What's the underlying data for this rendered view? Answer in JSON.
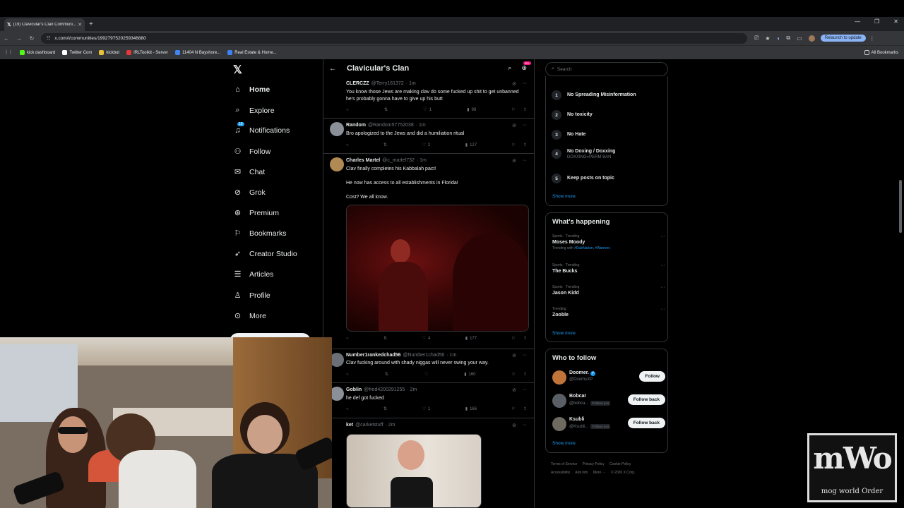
{
  "browser": {
    "tab_title": "(19) Clavicular's Clan Communi...",
    "url": "x.com/i/communities/1992797520259346880",
    "relaunch": "Relaunch to update",
    "bookmarks": [
      "kick dashboard",
      "Twitter Com",
      "kickbot",
      "IRLToolkit - Server",
      "11404 N Bayshore...",
      "Real Estate & Home..."
    ],
    "all_bookmarks": "All Bookmarks"
  },
  "nav": {
    "items": [
      "Home",
      "Explore",
      "Notifications",
      "Follow",
      "Chat",
      "Grok",
      "Premium",
      "Bookmarks",
      "Creator Studio",
      "Articles",
      "Profile",
      "More"
    ],
    "notif_badge": "19"
  },
  "community": {
    "title": "Clavicular's Clan",
    "header_badge": "20+"
  },
  "tweets": [
    {
      "name": "CLERCZZ",
      "handle": "@Terry161372",
      "time": "· 1m",
      "text": "You know those Jews are making clav do some fucked up shit to get unbanned he's probably gonna have to give up his butt",
      "likes": "1",
      "views": "98"
    },
    {
      "name": "Random",
      "handle": "@Random57752038",
      "time": "· 1m",
      "text": "Bro apologized to the Jews and did a humiliation ritual",
      "likes": "2",
      "views": "127"
    },
    {
      "name": "Charles Martel",
      "handle": "@c_martel732",
      "time": "· 1m",
      "text1": "Clav finally completes his Kabbalah pact!",
      "text2": "He now has access to all establishments in Florida!",
      "text3": "Cost? We all know.",
      "likes": "4",
      "views": "177"
    },
    {
      "name": "Number1rankedchad56",
      "handle": "@Number1chad56",
      "time": "· 1m",
      "text": "Clav fucking around with shady niggas will never swing your way.",
      "views": "160"
    },
    {
      "name": "Goblin",
      "handle": "@fred4200291255",
      "time": "· 2m",
      "text": "he def got fucked",
      "likes": "1",
      "views": "166"
    },
    {
      "name": "ket",
      "handle": "@carketstuff",
      "time": "· 2m"
    }
  ],
  "search": {
    "placeholder": "Search"
  },
  "rules": [
    {
      "num": "1",
      "title": "No Spreading Misinformation"
    },
    {
      "num": "2",
      "title": "No toxicity"
    },
    {
      "num": "3",
      "title": "No Hate"
    },
    {
      "num": "4",
      "title": "No Doxing / Doxxing",
      "sub": "DOXXING=PERM BAN"
    },
    {
      "num": "5",
      "title": "Keep posts on topic"
    }
  ],
  "show_more": "Show more",
  "happening": {
    "title": "What's happening",
    "trends": [
      {
        "meta": "Sports · Trending",
        "name": "Moses Moody",
        "with_label": "Trending with",
        "tags": "#DubNation, #Warriors"
      },
      {
        "meta": "Sports · Trending",
        "name": "The Bucks"
      },
      {
        "meta": "Sports · Trending",
        "name": "Jason Kidd"
      },
      {
        "meta": "Trending",
        "name": "Zooble"
      }
    ]
  },
  "who_to_follow": {
    "title": "Who to follow",
    "users": [
      {
        "name": "Doomer.",
        "handle": "@DoomsXP",
        "button": "Follow"
      },
      {
        "name": "Bobcar",
        "handle": "@bobca...",
        "follows": "Follows you",
        "button": "Follow back"
      },
      {
        "name": "Ksubli",
        "handle": "@Ksubli...",
        "follows": "Follows you",
        "button": "Follow back"
      }
    ]
  },
  "footer": [
    "Terms of Service",
    "Privacy Policy",
    "Cookie Policy",
    "Accessibility",
    "Ads info",
    "More ···",
    "© 2026 X Corp."
  ],
  "logo": {
    "big": "mWo",
    "small": "mog world Order"
  },
  "colors": {
    "accent": "#1d9bf0",
    "bg": "#000000",
    "border": "#2f3336",
    "muted": "#71767b"
  }
}
